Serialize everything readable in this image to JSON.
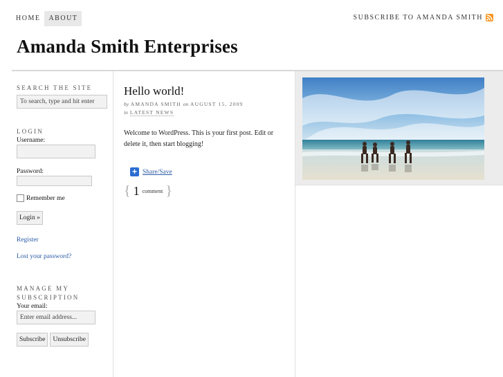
{
  "nav": {
    "items": [
      "HOME",
      "ABOUT"
    ],
    "active": "ABOUT"
  },
  "subscribe": {
    "label": "SUBSCRIBE TO AMANDA SMITH"
  },
  "site": {
    "title": "Amanda Smith Enterprises"
  },
  "sidebar": {
    "search": {
      "title": "Search the Site",
      "placeholder": "To search, type and hit enter"
    },
    "login": {
      "title": "Login",
      "username_label": "Username:",
      "password_label": "Password:",
      "remember_label": "Remember me",
      "button": "Login »",
      "register": "Register",
      "lost_password": "Lost your password?"
    },
    "subscription": {
      "title_line1": "Manage My",
      "title_line2": "Subscription",
      "email_label": "Your email:",
      "email_placeholder": "Enter email address...",
      "subscribe_btn": "Subscribe",
      "unsubscribe_btn": "Unsubscribe"
    }
  },
  "post": {
    "title": "Hello world!",
    "by": "by",
    "author": "AMANDA SMITH",
    "on": "on",
    "date": "AUGUST 15, 2009",
    "in": "in",
    "category": "LATEST NEWS",
    "body": "Welcome to WordPress. This is your first post. Edit or delete it, then start blogging!",
    "share": "Share/Save",
    "comment_count": "1",
    "comment_label": "comment"
  },
  "icons": {
    "rss": "rss-feed-icon",
    "share": "share-plus-icon"
  },
  "colors": {
    "link": "#2b5aa5",
    "rss": "#f7941d",
    "share": "#2b6dd1"
  }
}
